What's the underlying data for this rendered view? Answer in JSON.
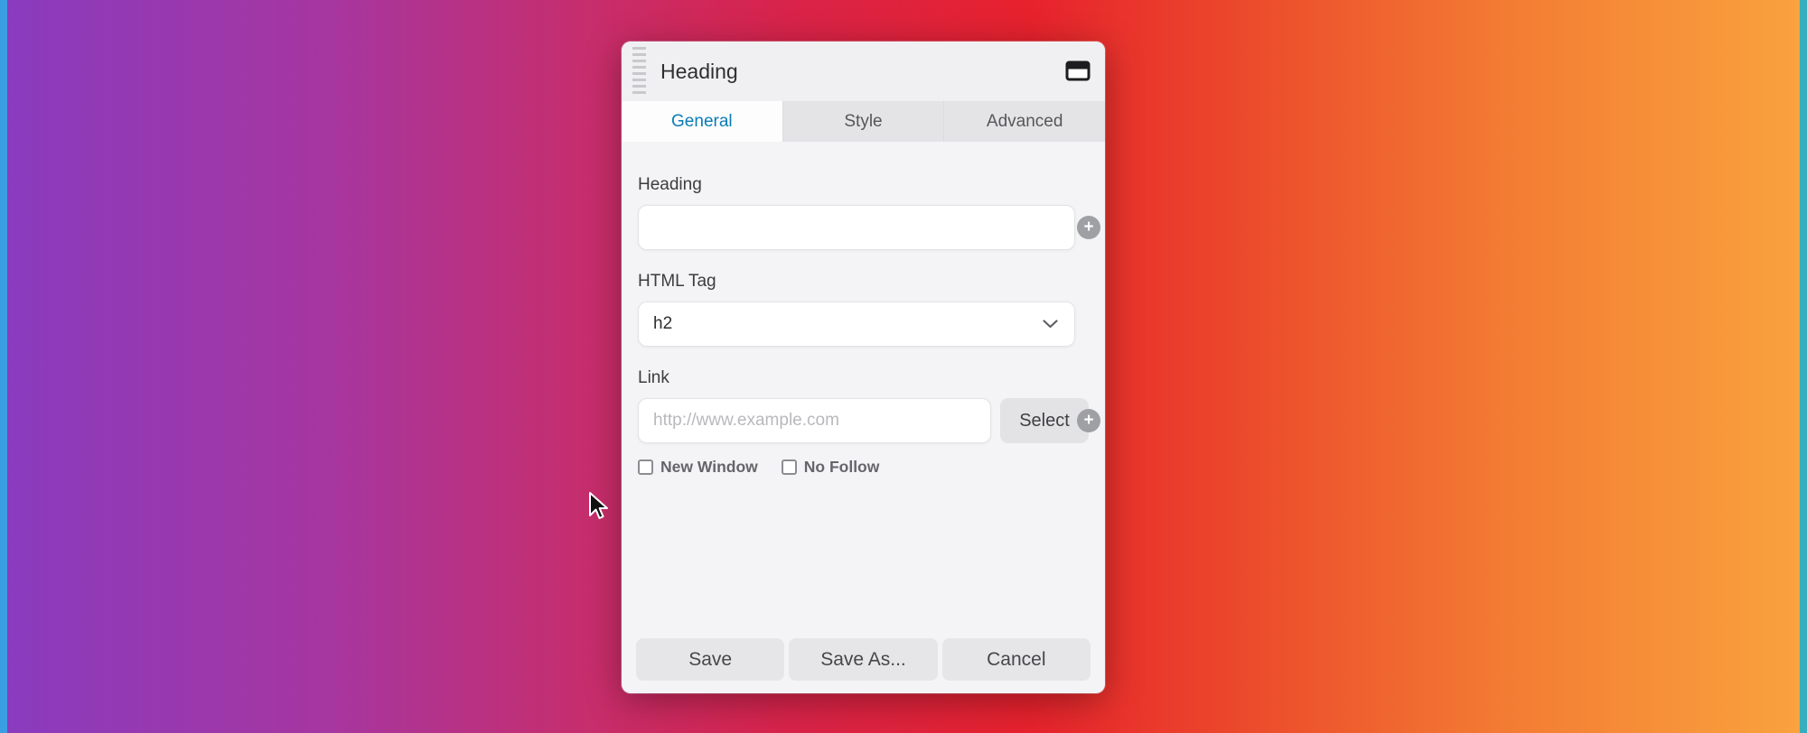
{
  "desktop": {
    "background": {
      "gradient_colors": [
        "#8a3bbe",
        "#d92349",
        "#e7222d",
        "#f9a23e"
      ],
      "left_strip_color": "#3b9ee2",
      "right_strip_color": "#35aebe"
    }
  },
  "dialog": {
    "title": "Heading",
    "accent_color": "#0a7cb5",
    "tabs": [
      {
        "label": "General",
        "active": true
      },
      {
        "label": "Style",
        "active": false
      },
      {
        "label": "Advanced",
        "active": false
      }
    ],
    "fields": {
      "heading": {
        "label": "Heading",
        "value": ""
      },
      "html_tag": {
        "label": "HTML Tag",
        "value": "h2"
      },
      "link": {
        "label": "Link",
        "placeholder": "http://www.example.com",
        "select_button": "Select",
        "checkboxes": [
          {
            "label": "New Window",
            "checked": false
          },
          {
            "label": "No Follow",
            "checked": false
          }
        ]
      }
    },
    "icons": {
      "drag_handle": "grip-lines-icon",
      "window_toggle": "window-icon",
      "field_connect": "plus-circle-icon",
      "dropdown": "chevron-down-icon",
      "plus_glyph": "+"
    },
    "footer": {
      "save": "Save",
      "save_as": "Save As...",
      "cancel": "Cancel"
    }
  }
}
